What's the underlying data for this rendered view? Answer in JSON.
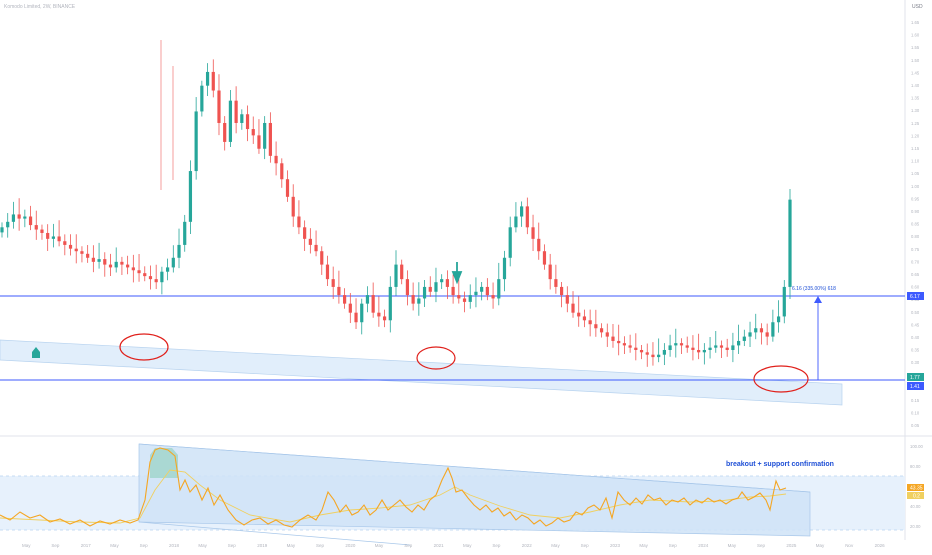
{
  "header": {
    "symbol": "Komodo Limited, 2W, BINANCE",
    "currency": "USD"
  },
  "price_axis": {
    "ticks": [
      "1.65",
      "1.60",
      "1.55",
      "1.50",
      "1.45",
      "1.40",
      "1.35",
      "1.30",
      "1.25",
      "1.20",
      "1.15",
      "1.10",
      "1.05",
      "1.00",
      "0.95",
      "0.90",
      "0.85",
      "0.80",
      "0.75",
      "0.70",
      "0.65",
      "0.60",
      "0.55",
      "0.50",
      "0.45",
      "0.40",
      "0.35",
      "0.30",
      "0.25",
      "0.20",
      "0.15",
      "0.10",
      "0.05"
    ],
    "upper_line_label": "6.17",
    "current_label": "1.77",
    "lower_line_label": "1.41"
  },
  "rsi_axis": {
    "ticks": [
      "100.00",
      "80.00",
      "60.00",
      "40.00",
      "20.00"
    ],
    "labels": [
      "43.35",
      "0.2"
    ]
  },
  "time_axis": [
    "May",
    "Sep",
    "2017",
    "May",
    "Sep",
    "2018",
    "May",
    "Sep",
    "2019",
    "May",
    "Sep",
    "2020",
    "May",
    "Sep",
    "2021",
    "May",
    "Sep",
    "2022",
    "May",
    "Sep",
    "2023",
    "May",
    "Sep",
    "2024",
    "May",
    "Sep",
    "2025",
    "May",
    "Nov",
    "2026"
  ],
  "annotations": {
    "measure": "6.16 (335.00%) 618",
    "breakout_note": "breakout + support confirmation"
  },
  "colors": {
    "up": "#26a69a",
    "down": "#ef5350",
    "line": "#3d5afe",
    "rsi": "#f5a623",
    "rsi_ma": "#f0d060",
    "channel": "#cfe3f7",
    "circle": "#e0201b",
    "annotation": "#1e4fd6"
  },
  "chart_data": {
    "type": "candlestick",
    "timeframe": "2W",
    "series": [
      {
        "name": "Komodo Limited",
        "kind": "ohlc",
        "closes": [
          1.5,
          1.55,
          1.62,
          1.58,
          1.6,
          1.52,
          1.48,
          1.45,
          1.4,
          1.42,
          1.38,
          1.35,
          1.32,
          1.3,
          1.28,
          1.25,
          1.22,
          1.24,
          1.2,
          1.18,
          1.22,
          1.2,
          1.18,
          1.16,
          1.14,
          1.12,
          1.1,
          1.08,
          1.15,
          1.18,
          1.25,
          1.35,
          1.55,
          2.1,
          3.0,
          3.5,
          3.8,
          3.4,
          2.8,
          2.5,
          3.2,
          2.8,
          2.95,
          2.7,
          2.6,
          2.4,
          2.8,
          2.3,
          2.2,
          2.0,
          1.8,
          1.6,
          1.5,
          1.4,
          1.35,
          1.3,
          1.2,
          1.1,
          1.05,
          1.0,
          0.95,
          0.9,
          0.85,
          0.95,
          1.0,
          0.9,
          0.88,
          0.86,
          1.05,
          1.2,
          1.1,
          1.0,
          0.95,
          0.98,
          1.05,
          1.02,
          1.08,
          1.1,
          1.05,
          1.0,
          0.98,
          0.96,
          1.0,
          1.02,
          1.05,
          1.0,
          0.98,
          1.1,
          1.25,
          1.5,
          1.6,
          1.7,
          1.5,
          1.4,
          1.3,
          1.2,
          1.1,
          1.05,
          1.0,
          0.95,
          0.9,
          0.88,
          0.86,
          0.84,
          0.82,
          0.8,
          0.78,
          0.76,
          0.75,
          0.74,
          0.73,
          0.72,
          0.71,
          0.7,
          0.69,
          0.7,
          0.72,
          0.74,
          0.75,
          0.74,
          0.73,
          0.72,
          0.71,
          0.72,
          0.73,
          0.74,
          0.73,
          0.72,
          0.74,
          0.76,
          0.78,
          0.8,
          0.82,
          0.8,
          0.78,
          0.85,
          0.88,
          1.05,
          1.77
        ]
      },
      {
        "name": "RSI",
        "kind": "line"
      }
    ],
    "horizontal_lines": [
      {
        "label": "6.17"
      },
      {
        "label": "1.41"
      }
    ],
    "measure_label": "6.16 (335.00%) 618"
  }
}
